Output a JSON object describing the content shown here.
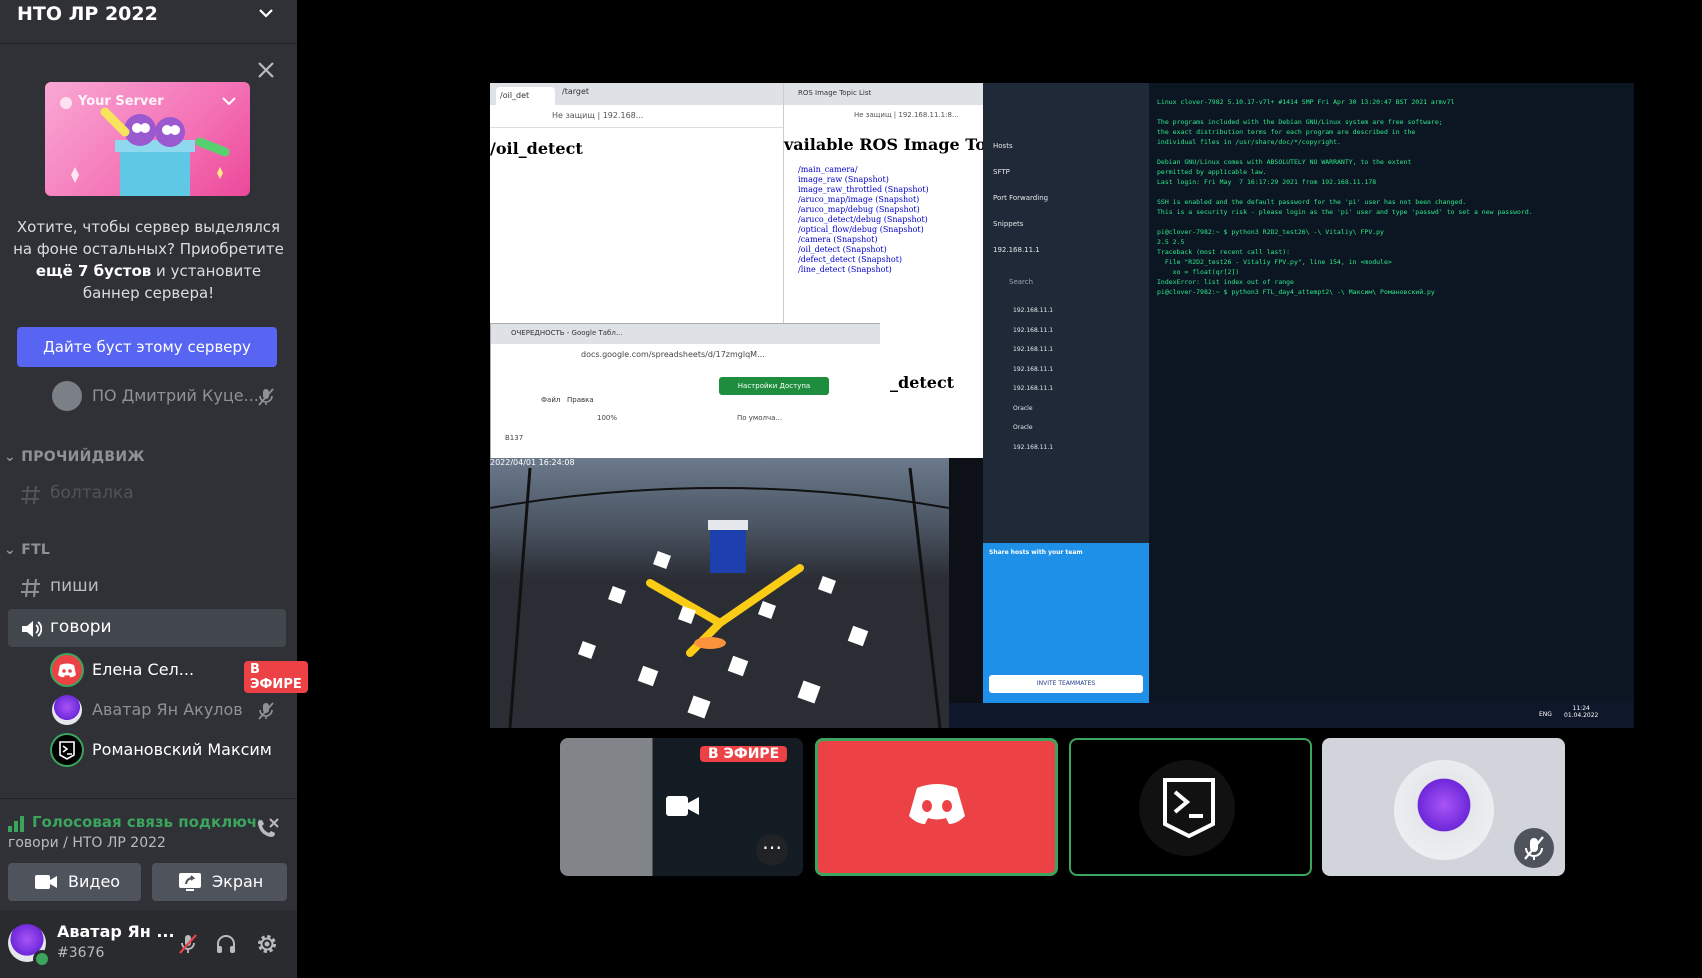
{
  "server": {
    "name": "НТО ЛР 2022"
  },
  "boost": {
    "banner_title": "Your Server",
    "text_1": "Хотите, чтобы сервер выделялся на фоне остальных? Приобретите ",
    "text_bold": "ещё 7 бустов",
    "text_2": " и установите баннер сервера!",
    "button": "Дайте буст этому серверу"
  },
  "members_top": [
    {
      "name": "ПО Дмитрий Куце..."
    }
  ],
  "categories": [
    {
      "name": "ПРОЧИЙДВИЖ",
      "channels": [
        {
          "name": "болталка",
          "type": "text"
        }
      ]
    },
    {
      "name": "FTL",
      "channels": [
        {
          "name": "пиши",
          "type": "text"
        },
        {
          "name": "говори",
          "type": "voice"
        }
      ]
    }
  ],
  "voice_members": [
    {
      "name": "Елена Сел...",
      "badge": "В ЭФИРЕ"
    },
    {
      "name": "Аватар Ян Акулов"
    },
    {
      "name": "Романовский Максим"
    }
  ],
  "voice": {
    "status": "Голосовая связь подключена",
    "location": "говори / НТО ЛР 2022",
    "video_label": "Видео",
    "screen_label": "Экран"
  },
  "user": {
    "name": "Аватар Ян ...",
    "tag": "#3676"
  },
  "stream": {
    "tab_1": "/oil_det",
    "tab_2": "/target",
    "tab_3": "ROS Image Topic List",
    "url_1": "192.168...",
    "url_2": "192.168.11.1:8...",
    "not_secure": "Не защищ",
    "page_1_title": "/oil_detect",
    "page_2_title": "vailable ROS Image Top",
    "ros_topics": [
      "/main_camera/",
      "image_raw (Snapshot)",
      "image_raw_throttled (Snapshot)",
      "/aruco_map/image (Snapshot)",
      "/aruco_map/debug (Snapshot)",
      "/aruco_detect/debug (Snapshot)",
      "/optical_flow/debug (Snapshot)",
      "/camera (Snapshot)",
      "/oil_detect (Snapshot)",
      "/defect_detect (Snapshot)",
      "/line_detect (Snapshot)"
    ],
    "page_3_title": "_detect",
    "sheets_tab": "ОЧЕРЕДНОСТЬ - Google Табл...",
    "sheets_url": "docs.google.com/spreadsheets/d/17zmglqM...",
    "sheets_menu": [
      "Файл",
      "Правка"
    ],
    "sheets_share": "Настройки Доступа",
    "sheets_zoom": "100%",
    "sheets_cell": "B137",
    "sheets_font": "По умолча...",
    "cam_timestamp": "2022/04/01 16:24:08",
    "ssh_hosts": [
      "Hosts",
      "SFTP",
      "Port Forwarding",
      "Snippets",
      "192.168.11.1"
    ],
    "ssh_search": "Search",
    "ssh_list": [
      "192.168.11.1",
      "192.168.11.1",
      "192.168.11.1",
      "192.168.11.1",
      "192.168.11.1",
      "Oracle",
      "Oracle",
      "192.168.11.1"
    ],
    "ssh_promo": "Share hosts with your team",
    "ssh_invite": "INVITE TEAMMATES",
    "terminal": [
      "Linux clover-7982 5.10.17-v7l+ #1414 SMP Fri Apr 30 13:20:47 BST 2021 armv7l",
      "",
      "The programs included with the Debian GNU/Linux system are free software;",
      "the exact distribution terms for each program are described in the",
      "individual files in /usr/share/doc/*/copyright.",
      "",
      "Debian GNU/Linux comes with ABSOLUTELY NO WARRANTY, to the extent",
      "permitted by applicable law.",
      "Last login: Fri May  7 16:17:29 2021 from 192.168.11.178",
      "",
      "SSH is enabled and the default password for the 'pi' user has not been changed.",
      "This is a security risk - please login as the 'pi' user and type 'passwd' to set a new password.",
      "",
      "pi@clover-7982:~ $ python3 R2D2_test26\\ -\\ Vitaliy\\ FPV.py",
      "2.5 2.5",
      "Traceback (most recent call last):",
      "  File \"R2D2_test26 - Vitaliy FPV.py\", line 154, in <module>",
      "    xo = float(qr[2])",
      "IndexError: list index out of range",
      "pi@clover-7982:~ $ python3 FTL_day4_attempt2\\ -\\ Максим\\ Романовский.py"
    ],
    "taskbar_lang": "ENG",
    "taskbar_time": "11:24",
    "taskbar_date": "01.04.2022"
  },
  "tiles": {
    "live_badge": "В ЭФИРЕ"
  },
  "colors": {
    "accent": "#5865f2",
    "live": "#ed4245",
    "connected": "#3ba55d",
    "speaking": "#3ba55d"
  }
}
